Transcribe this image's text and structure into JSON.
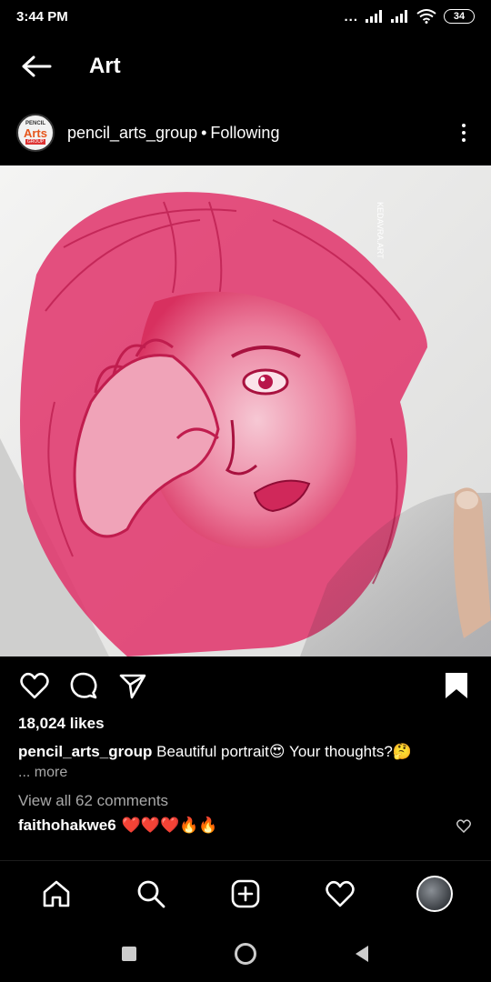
{
  "status_bar": {
    "time": "3:44 PM",
    "dots": "...",
    "battery": "34"
  },
  "app_bar": {
    "title": "Art"
  },
  "post": {
    "avatar": {
      "line1": "PENCIL",
      "line2": "Arts",
      "line3": "GROUP"
    },
    "username": "pencil_arts_group",
    "separator": "•",
    "follow_status": "Following",
    "image_description_icon": "pink-pencil-portrait",
    "watermark": "KEDAVRA.ART",
    "likes": "18,024 likes",
    "caption_user": "pencil_arts_group",
    "caption_text": "Beautiful portrait😍 Your thoughts?🤔",
    "more_label": "... more",
    "view_comments": "View all 62 comments",
    "comment_user": "faithohakwe6",
    "comment_text": "❤️❤️❤️🔥🔥"
  },
  "colors": {
    "background": "#000000",
    "text": "#ffffff",
    "muted": "#a8a8a8",
    "sketch": "#e0326a"
  }
}
